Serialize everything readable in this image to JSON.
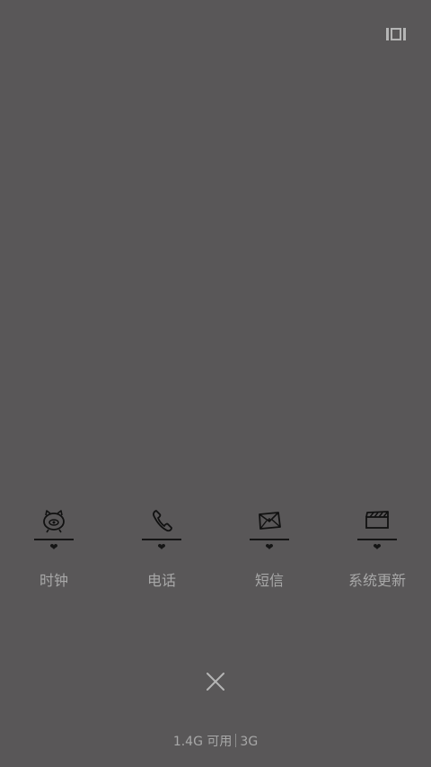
{
  "top_right_icon": "view-cards-icon",
  "apps": [
    {
      "icon": "clock-icon",
      "label": "时钟",
      "heart": "❤"
    },
    {
      "icon": "phone-icon",
      "label": "电话",
      "heart": "❤"
    },
    {
      "icon": "message-icon",
      "label": "短信",
      "heart": "❤"
    },
    {
      "icon": "system-update-icon",
      "label": "系统更新",
      "heart": "❤"
    }
  ],
  "close_icon": "close-icon",
  "storage": {
    "available": "1.4G 可用",
    "network": "3G"
  }
}
